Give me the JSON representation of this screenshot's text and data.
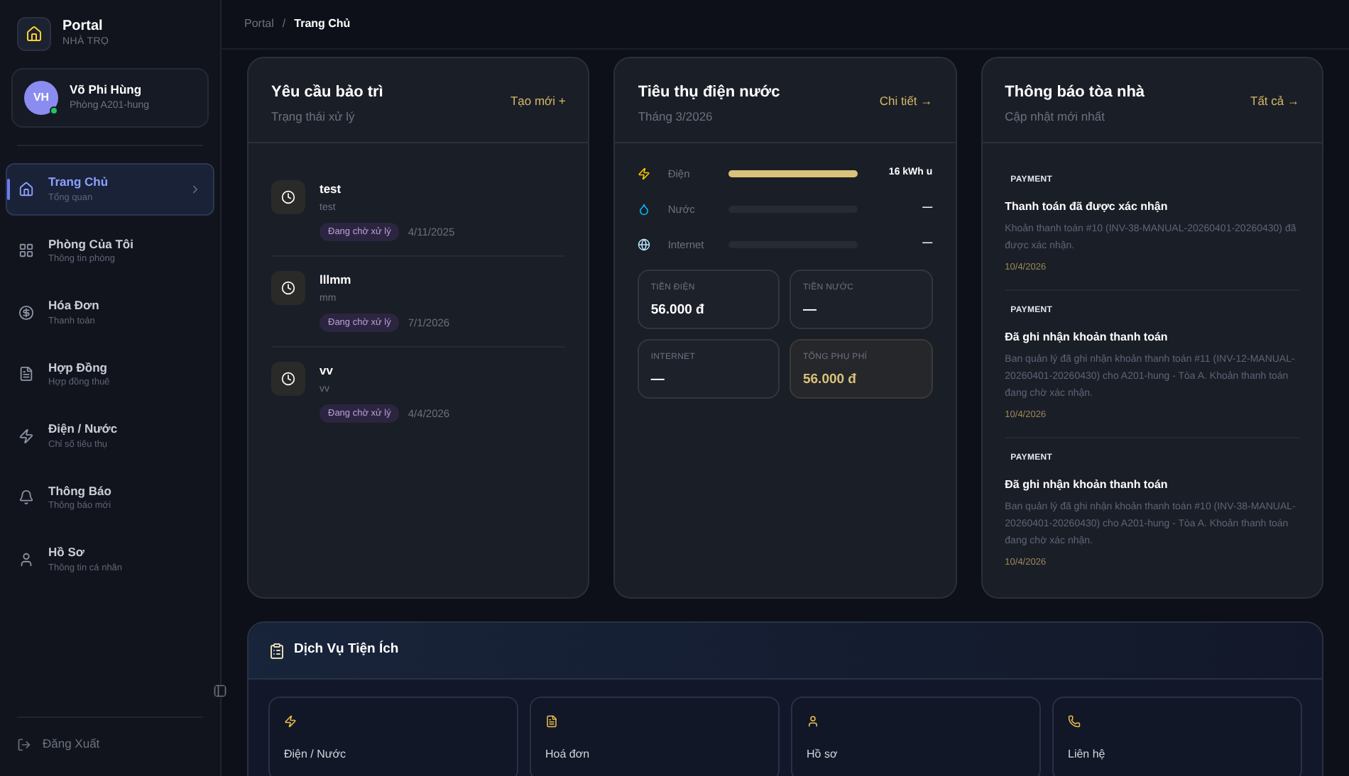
{
  "brand": {
    "title": "Portal",
    "subtitle": "NHÀ TRỌ"
  },
  "user": {
    "initials": "VH",
    "name": "Võ Phi Hùng",
    "room": "Phòng A201-hung",
    "online": true
  },
  "sidebar": {
    "items": [
      {
        "kind": "home",
        "label": "Trang Chủ",
        "sub": "Tổng quan",
        "selected": true
      },
      {
        "kind": "grid",
        "label": "Phòng Của Tôi",
        "sub": "Thông tin phòng",
        "selected": false
      },
      {
        "kind": "dollar",
        "label": "Hóa Đơn",
        "sub": "Thanh toán",
        "selected": false
      },
      {
        "kind": "file",
        "label": "Hợp Đồng",
        "sub": "Hợp đồng thuê",
        "selected": false
      },
      {
        "kind": "zap",
        "label": "Điện / Nước",
        "sub": "Chỉ số tiêu thụ",
        "selected": false
      },
      {
        "kind": "bell",
        "label": "Thông Báo",
        "sub": "Thông báo mới",
        "selected": false
      },
      {
        "kind": "user",
        "label": "Hồ Sơ",
        "sub": "Thông tin cá nhân",
        "selected": false
      }
    ],
    "logout": "Đăng Xuất"
  },
  "breadcrumb": [
    "Portal",
    "/",
    "Trang Chủ"
  ],
  "maintenance": {
    "title": "Yêu cầu bảo trì",
    "subtitle": "Trạng thái xử lý",
    "action": "Tạo mới +",
    "items": [
      {
        "title": "test",
        "desc": "test",
        "status": "Đang chờ xử lý",
        "date": "4/11/2025"
      },
      {
        "title": "lllmm",
        "desc": "mm",
        "status": "Đang chờ xử lý",
        "date": "7/1/2026"
      },
      {
        "title": "vv",
        "desc": "vv",
        "status": "Đang chờ xử lý",
        "date": "4/4/2026"
      }
    ]
  },
  "usage": {
    "title": "Tiêu thụ điện nước",
    "subtitle": "Tháng 3/2026",
    "action": "Chi tiết →",
    "meters": [
      {
        "kind": "electric",
        "label": "Điện",
        "level": 1,
        "reading": "16 kWh u"
      },
      {
        "kind": "water",
        "label": "Nước",
        "level": 0,
        "reading": "—"
      },
      {
        "kind": "internet",
        "label": "Internet",
        "level": 0,
        "reading": "—"
      }
    ],
    "costs": [
      {
        "label": "TIỀN ĐIỆN",
        "value": "56.000 đ",
        "highlighted": false
      },
      {
        "label": "TIỀN NƯỚC",
        "value": "—",
        "highlighted": false
      },
      {
        "label": "INTERNET",
        "value": "—",
        "highlighted": false
      },
      {
        "label": "TỔNG PHỤ PHÍ",
        "value": "56.000 đ",
        "highlighted": true
      }
    ]
  },
  "notices": {
    "title": "Thông báo tòa nhà",
    "subtitle": "Cập nhật mới nhất",
    "action": "Tất cả →",
    "items": [
      {
        "tag": "PAYMENT",
        "title": "Thanh toán đã được xác nhận",
        "body": "Khoản thanh toán #10 (INV-38-MANUAL-20260401-20260430) đã được xác nhận.",
        "date": "10/4/2026"
      },
      {
        "tag": "PAYMENT",
        "title": "Đã ghi nhận khoản thanh toán",
        "body": "Ban quản lý đã ghi nhận khoản thanh toán #11 (INV-12-MANUAL-20260401-20260430) cho A201-hung - Tòa A. Khoản thanh toán đang chờ xác nhận.",
        "date": "10/4/2026"
      },
      {
        "tag": "PAYMENT",
        "title": "Đã ghi nhận khoản thanh toán",
        "body": "Ban quản lý đã ghi nhận khoản thanh toán #10 (INV-38-MANUAL-20260401-20260430) cho A201-hung - Tòa A. Khoản thanh toán đang chờ xác nhận.",
        "date": "10/4/2026"
      }
    ]
  },
  "services": {
    "title": "Dịch Vụ Tiện Ích",
    "items": [
      {
        "kind": "zap",
        "label": "Điện / Nước"
      },
      {
        "kind": "file",
        "label": "Hoá đơn"
      },
      {
        "kind": "user",
        "label": "Hồ sơ"
      },
      {
        "kind": "phone",
        "label": "Liên hệ"
      }
    ]
  }
}
